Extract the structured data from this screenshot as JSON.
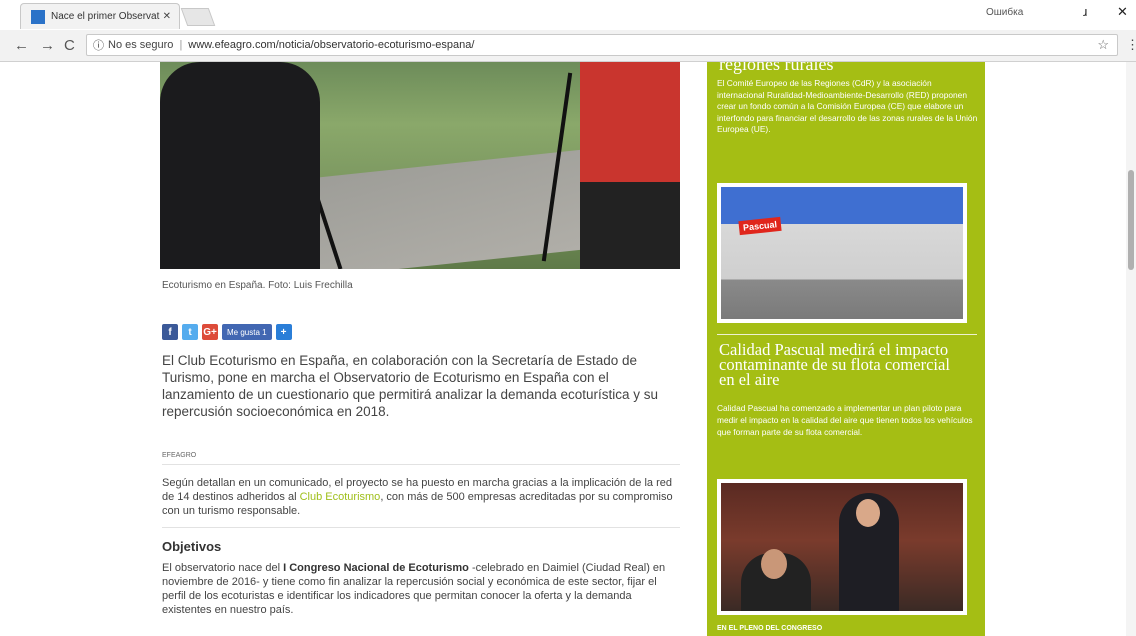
{
  "browser": {
    "tab_title": "Nace el primer Observat",
    "tab_close": "✕",
    "user_label": "Ошибка",
    "nav": {
      "back": "←",
      "forward": "→",
      "reload": "C"
    },
    "security_label": "No es seguro",
    "url": "www.efeagro.com/noticia/observatorio-ecoturismo-espana/",
    "star": "☆",
    "menu": "⋮",
    "win_min": "ɹ",
    "win_close": "✕"
  },
  "article": {
    "image_caption": "Ecoturismo en España. Foto: Luis Frechilla",
    "share": {
      "facebook": "f",
      "twitter": "t",
      "googleplus": "G+",
      "like": "Me gusta 1",
      "more": "+"
    },
    "lead": "El Club Ecoturismo en España, en colaboración con la Secretaría de Estado de Turismo, pone en marcha el Observatorio de Ecoturismo en España con el lanzamiento de un cuestionario que permitirá analizar la demanda ecoturística y su repercusión socioeconómica en 2018.",
    "label": "EFEAGRO",
    "para1_a": "Según detallan en un comunicado, el proyecto se ha puesto en marcha gracias a la implicación de la red de 14 destinos adheridos al ",
    "para1_link": "Club Ecoturismo",
    "para1_b": ", con más de 500 empresas acreditadas por su compromiso con un turismo responsable.",
    "heading": "Objetivos",
    "para2_a": "El observatorio nace del ",
    "para2_bold": "I Congreso Nacional de Ecoturismo",
    "para2_b": " -celebrado en Daimiel (Ciudad Real) en noviembre de 2016- y tiene como fin analizar la repercusión social y económica de este sector, fijar el perfil de los ecoturistas e identificar los indicadores que permitan conocer la oferta y la demanda existentes en nuestro país."
  },
  "sidebar": {
    "top_title": "regiones rurales",
    "text1": "El Comité Europeo de las Regiones (CdR) y la asociación internacional Ruralidad-Medioambiente-Desarrollo (RED) proponen crear un fondo común a la Comisión Europea (CE) que elabore un interfondo para financiar el desarrollo de las zonas rurales de la Unión Europea (UE).",
    "img1_brand": "Pascual",
    "title2": "Calidad Pascual medirá el impacto contaminante de su flota comercial en el aire",
    "text2": "Calidad Pascual ha comenzado a implementar un plan piloto para medir el impacto en la calidad del aire que tienen todos los vehículos que forman parte de su flota comercial.",
    "caption2": "EN EL PLENO DEL CONGRESO"
  }
}
